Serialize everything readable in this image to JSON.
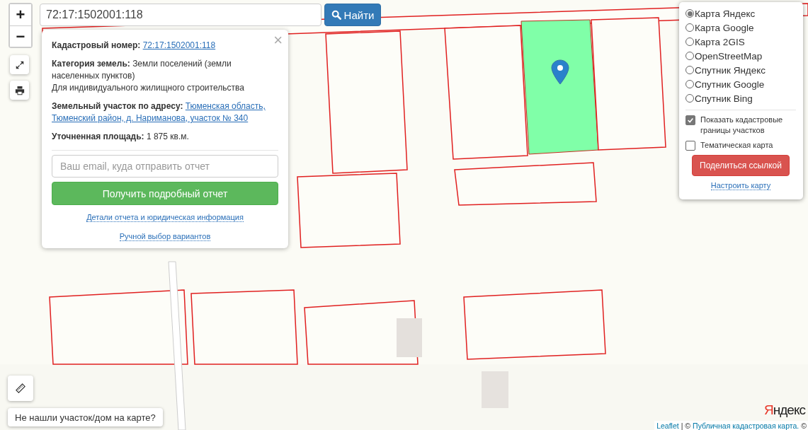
{
  "zoom": {
    "zoom_in": "+",
    "zoom_out": "−"
  },
  "search": {
    "value": "72:17:1502001:118",
    "button": "Найти"
  },
  "popup": {
    "close": "×",
    "fields": [
      {
        "label": "Кадастровый номер:",
        "value": "72:17:1502001:118",
        "kind": "link"
      },
      {
        "label": "Категория земель:",
        "value": "Земли поселений (земли населенных пунктов)",
        "note": "Для индивидуального жилищного строительства",
        "kind": "text"
      },
      {
        "label": "Земельный участок по адресу:",
        "value_lines": [
          "Тюменская область,",
          "Тюменский район, д. Нариманова, участок № 340"
        ],
        "kind": "link"
      },
      {
        "label": "Уточненная площадь:",
        "value": "1 875 кв.м.",
        "kind": "text"
      }
    ],
    "email": {
      "placeholder": "Ваш email, куда отправить отчет"
    },
    "submit_button": "Получить подробный отчет",
    "links": [
      "Детали отчета и юридическая информация",
      "Ручной выбор вариантов"
    ]
  },
  "layers": {
    "map_types": [
      {
        "label": "Карта Яндекс",
        "selected": true
      },
      {
        "label": "Карта Google",
        "selected": false
      },
      {
        "label": "Карта 2GIS",
        "selected": false
      },
      {
        "label": "OpenStreetMap",
        "selected": false
      },
      {
        "label": "Спутник Яндекс",
        "selected": false
      },
      {
        "label": "Спутник Google",
        "selected": false
      },
      {
        "label": "Спутник Bing",
        "selected": false
      }
    ],
    "options": [
      {
        "label": "Показать кадастровые границы участков",
        "checked": true
      },
      {
        "label": "Тематическая карта",
        "checked": false
      }
    ],
    "share_button": "Поделиться ссылкой",
    "settings_link": "Настроить карту"
  },
  "not_found_button": "Не нашли участок/дом на карте?",
  "map_logo": "Яндекс",
  "attribution": [
    {
      "text": "Leaflet",
      "kind": "link"
    },
    {
      "text": "| ©",
      "kind": "text"
    },
    {
      "text": "Публичная кадастровая карта.",
      "kind": "link"
    },
    {
      "text": "©",
      "kind": "text"
    }
  ]
}
